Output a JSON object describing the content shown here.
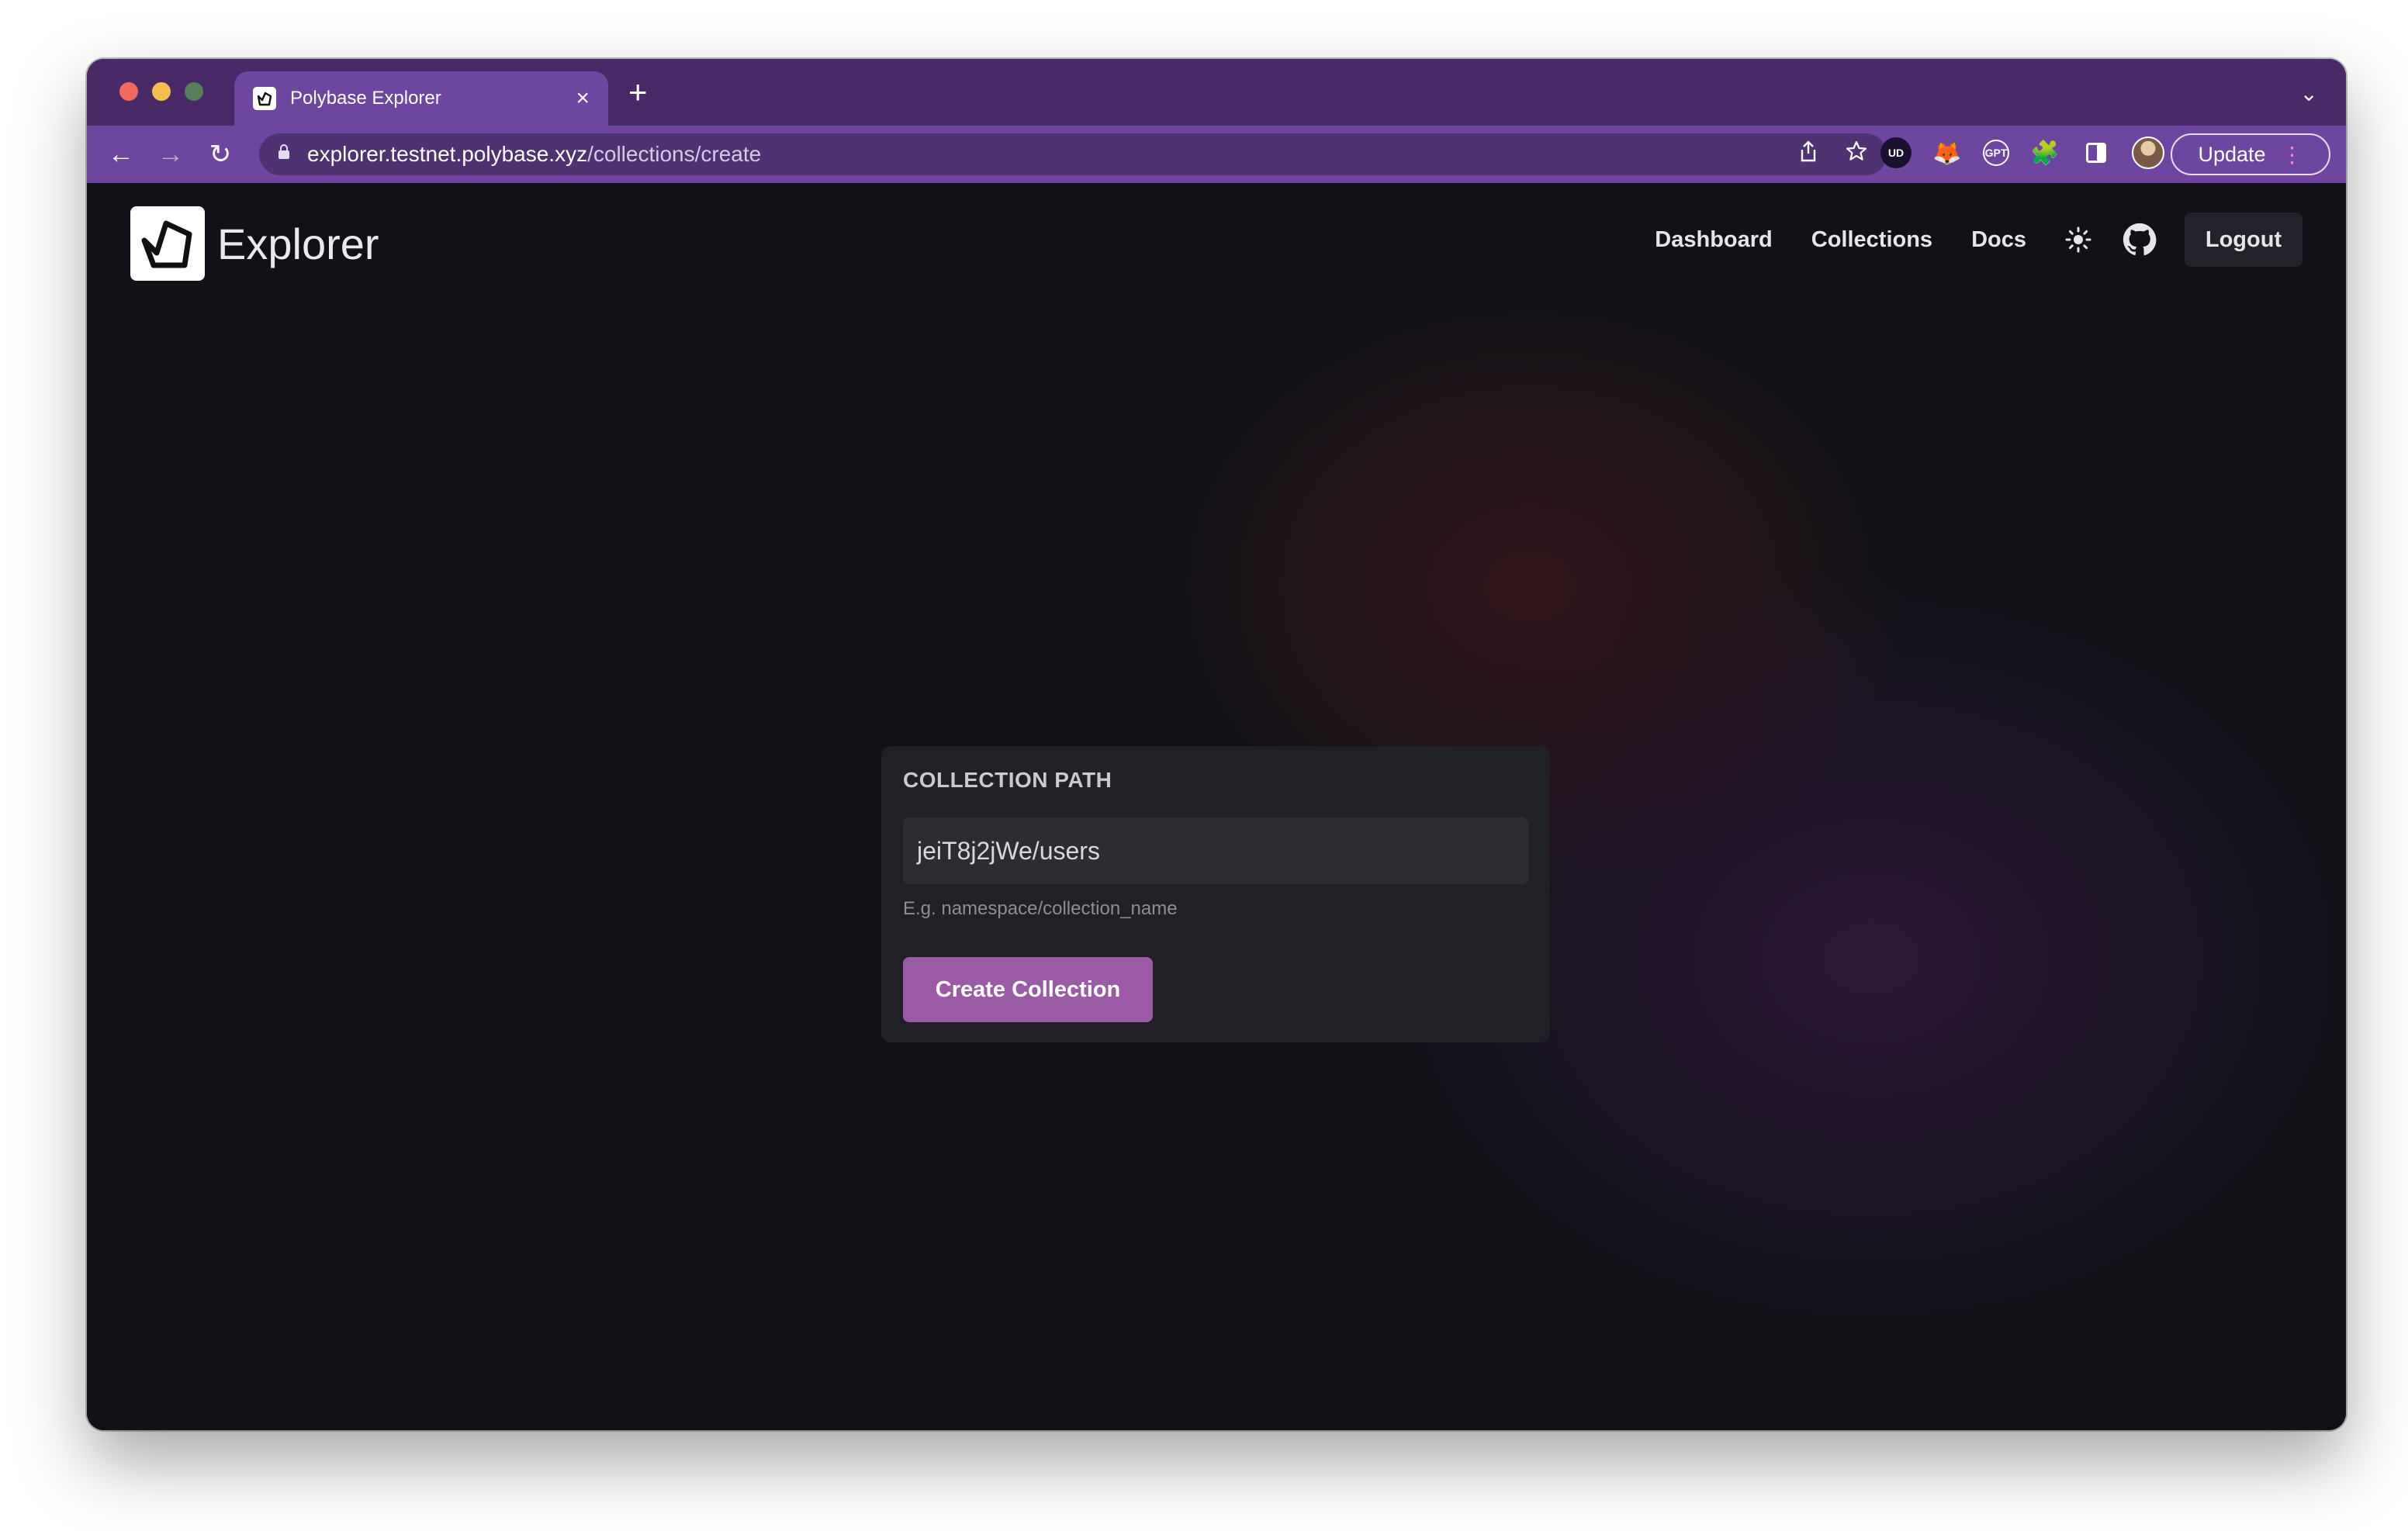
{
  "browser": {
    "tab_title": "Polybase Explorer",
    "tab_close": "×",
    "new_tab": "+",
    "tab_dropdown": "⌄",
    "url_host": "explorer.testnet.polybase.xyz",
    "url_path": "/collections/create",
    "update_label": "Update",
    "update_menu": "⋮",
    "nav_back": "←",
    "nav_forward": "→",
    "nav_reload": "↻",
    "icons": {
      "lock": "lock-icon",
      "share": "share-icon",
      "bookmark": "star-icon",
      "ext_ud": "UD",
      "ext_fox": "🦊",
      "ext_gpt": "GPT",
      "ext_puzzle": "🧩"
    }
  },
  "header": {
    "logo_text": "Explorer",
    "nav": {
      "dashboard": "Dashboard",
      "collections": "Collections",
      "docs": "Docs"
    },
    "logout_label": "Logout",
    "icons": {
      "theme": "sun-icon",
      "github": "github-icon"
    }
  },
  "form": {
    "label": "COLLECTION PATH",
    "input_value": "jeiT8j2jWe/users",
    "hint": "E.g. namespace/collection_name",
    "submit_label": "Create Collection"
  },
  "colors": {
    "accent": "#9a5aa6",
    "browser_chrome": "#6e46a0",
    "page_bg": "#111217"
  }
}
